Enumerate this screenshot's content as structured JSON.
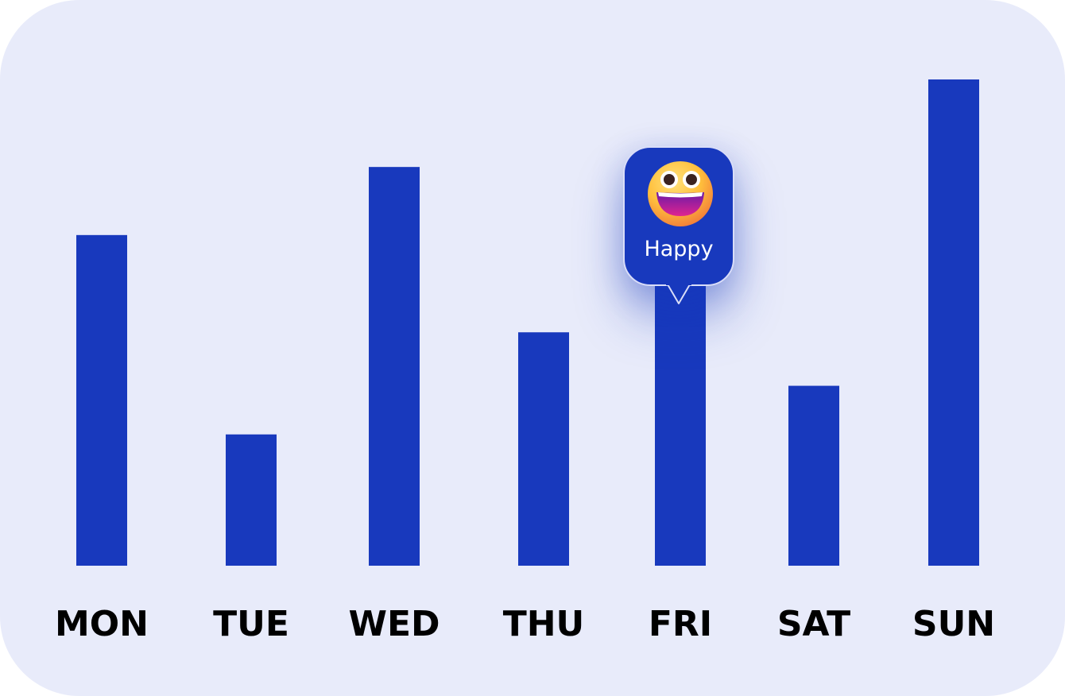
{
  "chart_data": {
    "type": "bar",
    "categories": [
      "MON",
      "TUE",
      "WED",
      "THU",
      "FRI",
      "SAT",
      "SUN"
    ],
    "values": [
      6.8,
      2.7,
      8.2,
      4.8,
      6.0,
      3.7,
      10.0
    ],
    "title": "",
    "xlabel": "",
    "ylabel": "",
    "ylim": [
      0,
      10
    ],
    "grid": false,
    "legend": "none",
    "bar_color": "#1839bd",
    "background_color": "#e8ebfa"
  },
  "tooltip": {
    "category": "FRI",
    "label": "Happy",
    "icon": "grinning-face-emoji-icon"
  }
}
